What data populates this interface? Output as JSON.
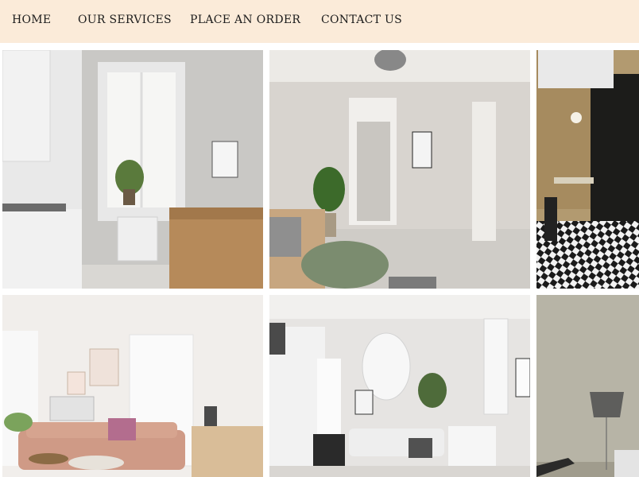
{
  "nav": {
    "items": [
      {
        "label": "HOME"
      },
      {
        "label": "OUR SERVICES"
      },
      {
        "label": "PLACE AN ORDER"
      },
      {
        "label": "CONTACT US"
      }
    ]
  },
  "gallery": {
    "images": [
      {
        "subject": "white-kitchen-photo"
      },
      {
        "subject": "living-room-with-chandelier-photo"
      },
      {
        "subject": "cafe-with-checkered-floor-photo"
      },
      {
        "subject": "living-room-with-pink-sofa-photo"
      },
      {
        "subject": "white-lounge-with-pendant-lamp-photo"
      },
      {
        "subject": "room-with-floor-lamp-photo"
      }
    ]
  },
  "colors": {
    "nav_background": "#fbebd9",
    "nav_text": "#1c1c1c",
    "page_background": "#ffffff"
  }
}
